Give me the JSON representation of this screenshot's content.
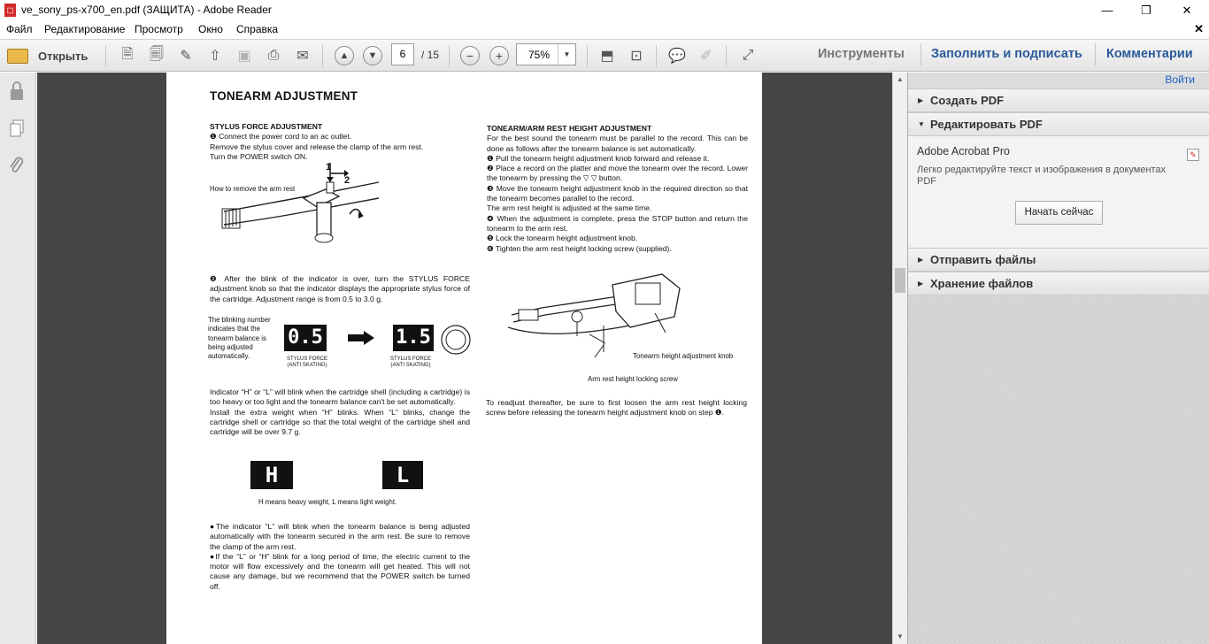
{
  "window": {
    "title": "ve_sony_ps-x700_en.pdf (ЗАЩИТА) - Adobe Reader",
    "minimize": "—",
    "restore": "❐",
    "close": "✕"
  },
  "menu": {
    "items": [
      "Файл",
      "Редактирование",
      "Просмотр",
      "Окно",
      "Справка"
    ],
    "close_doc": "✕"
  },
  "toolbar": {
    "open_label": "Открыть",
    "current_page": "6",
    "page_total": "/ 15",
    "zoom": "75%",
    "panes": [
      "Инструменты",
      "Заполнить и подписать",
      "Комментарии"
    ]
  },
  "document": {
    "title": "TONEARM ADJUSTMENT",
    "left": {
      "heading": "STYLUS FORCE ADJUSTMENT",
      "p1": "❶ Connect the power cord to an ac outlet.",
      "p2": "Remove the stylus cover and release the clamp of the arm rest.",
      "p3": "Turn the POWER switch ON.",
      "fig1_caption": "How to remove the arm rest",
      "fig1_label1": "1",
      "fig1_label2": "2",
      "p4": "❷ After the blink of the indicator is over, turn the STYLUS FORCE adjustment knob so that the indicator displays the appropriate stylus force of the cartridge. Adjustment range is from 0.5 to 3.0 g.",
      "fig2_caption": "The blinking number indicates that the tonearm balance is being adjusted automatically.",
      "display_a": "0.5",
      "display_b": "1.5",
      "display_caption": "STYLUS FORCE (ANTI SKATING)",
      "p5": "Indicator “H” or “L” will blink when the cartridge shell (including a cartridge) is too heavy or too light and the tonearm balance can't be set automatically.",
      "p6": "Install the extra weight when “H” blinks. When “L” blinks, change the cartridge shell or cartridge so that the total weight of the cartridge shell and cartridge will be over 9.7 g.",
      "display_h": "H",
      "display_l": "L",
      "hl_caption": "H means heavy weight, L means light weight.",
      "p7": "●The indicator “L” will blink when the tonearm balance is being adjusted automatically with the tonearm secured in the arm rest. Be sure to remove the clamp of the arm rest.",
      "p8": "●If the “L” or “H” blink for a long period of time, the electric current to the motor will flow excessively and the tonearm will get heated. This will not cause any damage, but we recommend that the POWER switch be turned off."
    },
    "right": {
      "heading": "TONEARM/ARM REST HEIGHT ADJUSTMENT",
      "p1": "For the best sound the tonearm must be parallel to the record. This can be done as follows after the tonearm balance is set automatically.",
      "s1": "❶ Pull the tonearm height adjustment knob forward and release it.",
      "s2": "❷ Place a record on the platter and move the tonearm over the record. Lower the tonearm by pressing the ▽ ▽ button.",
      "s3": "❸ Move the tonearm height adjustment knob in the required direction so that the tonearm becomes parallel to the record.",
      "s3b": "The arm rest height is adjusted at the same time.",
      "s4": "❹ When the adjustment is complete, press the STOP button and return the tonearm to the arm rest.",
      "s5": "❺ Lock the tonearm height adjustment knob.",
      "s6": "❻ Tighten the arm rest height locking screw (supplied).",
      "fig_label1": "Tonearm height adjustment knob",
      "fig_label2": "Arm rest height locking screw",
      "p2": "To readjust thereafter, be sure to first loosen the arm rest height locking screw before releasing the tonearm height adjustment knob on step ❶."
    }
  },
  "right_panel": {
    "signin": "Войти",
    "sections": [
      "Создать PDF",
      "Редактировать PDF",
      "Отправить файлы",
      "Хранение файлов"
    ],
    "pro_title": "Adobe Acrobat Pro",
    "pro_desc": "Легко редактируйте текст и изображения в документах PDF",
    "start_button": "Начать сейчас"
  },
  "icons": [
    "lock-icon",
    "pages-icon",
    "paperclip-icon",
    "folder-icon",
    "print-icon",
    "mail-icon",
    "up-arrow-icon",
    "down-arrow-icon",
    "zoom-out-icon",
    "zoom-in-icon",
    "fullscreen-icon"
  ]
}
